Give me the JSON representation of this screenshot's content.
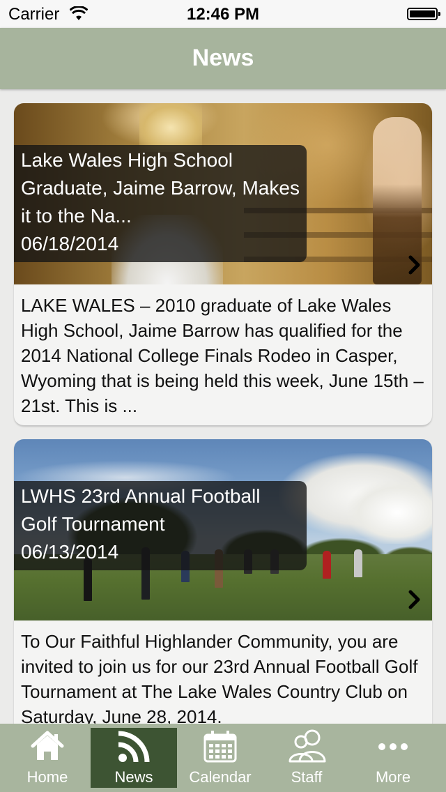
{
  "status_bar": {
    "carrier": "Carrier",
    "time": "12:46 PM"
  },
  "nav": {
    "title": "News"
  },
  "news_items": [
    {
      "title": "Lake Wales High School Graduate, Jaime Barrow, Makes it to the Na...",
      "date": "06/18/2014",
      "excerpt": "LAKE WALES – 2010 graduate of Lake Wales High School, Jaime Barrow has qualified for the 2014 National College Finals Rodeo in Casper, Wyoming that is being held this week, June 15th – 21st.  This is ..."
    },
    {
      "title": "LWHS 23rd Annual Football Golf Tournament",
      "date": "06/13/2014",
      "excerpt": "To Our Faithful Highlander Community, you are invited to join us for our 23rd Annual Football Golf Tournament at The Lake Wales Country Club on Saturday, June 28, 2014."
    }
  ],
  "tabs": [
    {
      "label": "Home",
      "icon": "home-icon",
      "active": false
    },
    {
      "label": "News",
      "icon": "rss-icon",
      "active": true
    },
    {
      "label": "Calendar",
      "icon": "calendar-icon",
      "active": false
    },
    {
      "label": "Staff",
      "icon": "staff-icon",
      "active": false
    },
    {
      "label": "More",
      "icon": "more-icon",
      "active": false
    }
  ],
  "colors": {
    "nav_bar": "#a7b49d",
    "tab_bar": "#a8b59e",
    "tab_active": "#3d5433"
  }
}
